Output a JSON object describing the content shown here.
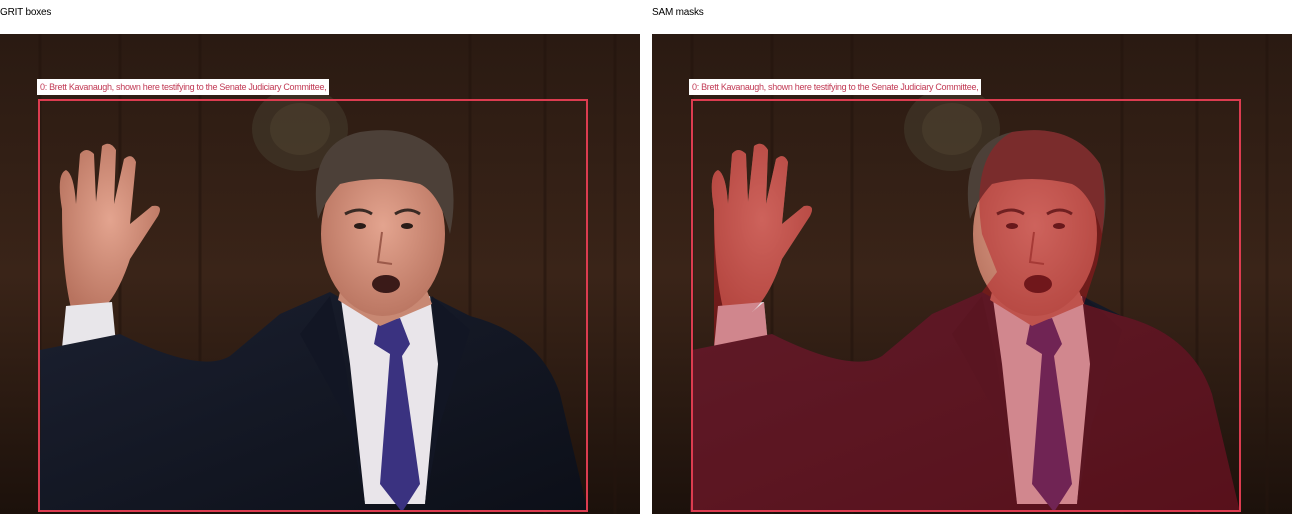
{
  "panels": {
    "grit": {
      "title": "GRIT boxes",
      "label": "0: Brett Kavanaugh, shown here testifying to the Senate Judiciary Committee,"
    },
    "sam": {
      "title": "SAM masks",
      "label": "0: Brett Kavanaugh, shown here testifying to the Senate Judiciary Committee,"
    }
  },
  "colors": {
    "box": "#dc3c50",
    "label_text": "#c23a55",
    "mask": "#b4141e"
  }
}
